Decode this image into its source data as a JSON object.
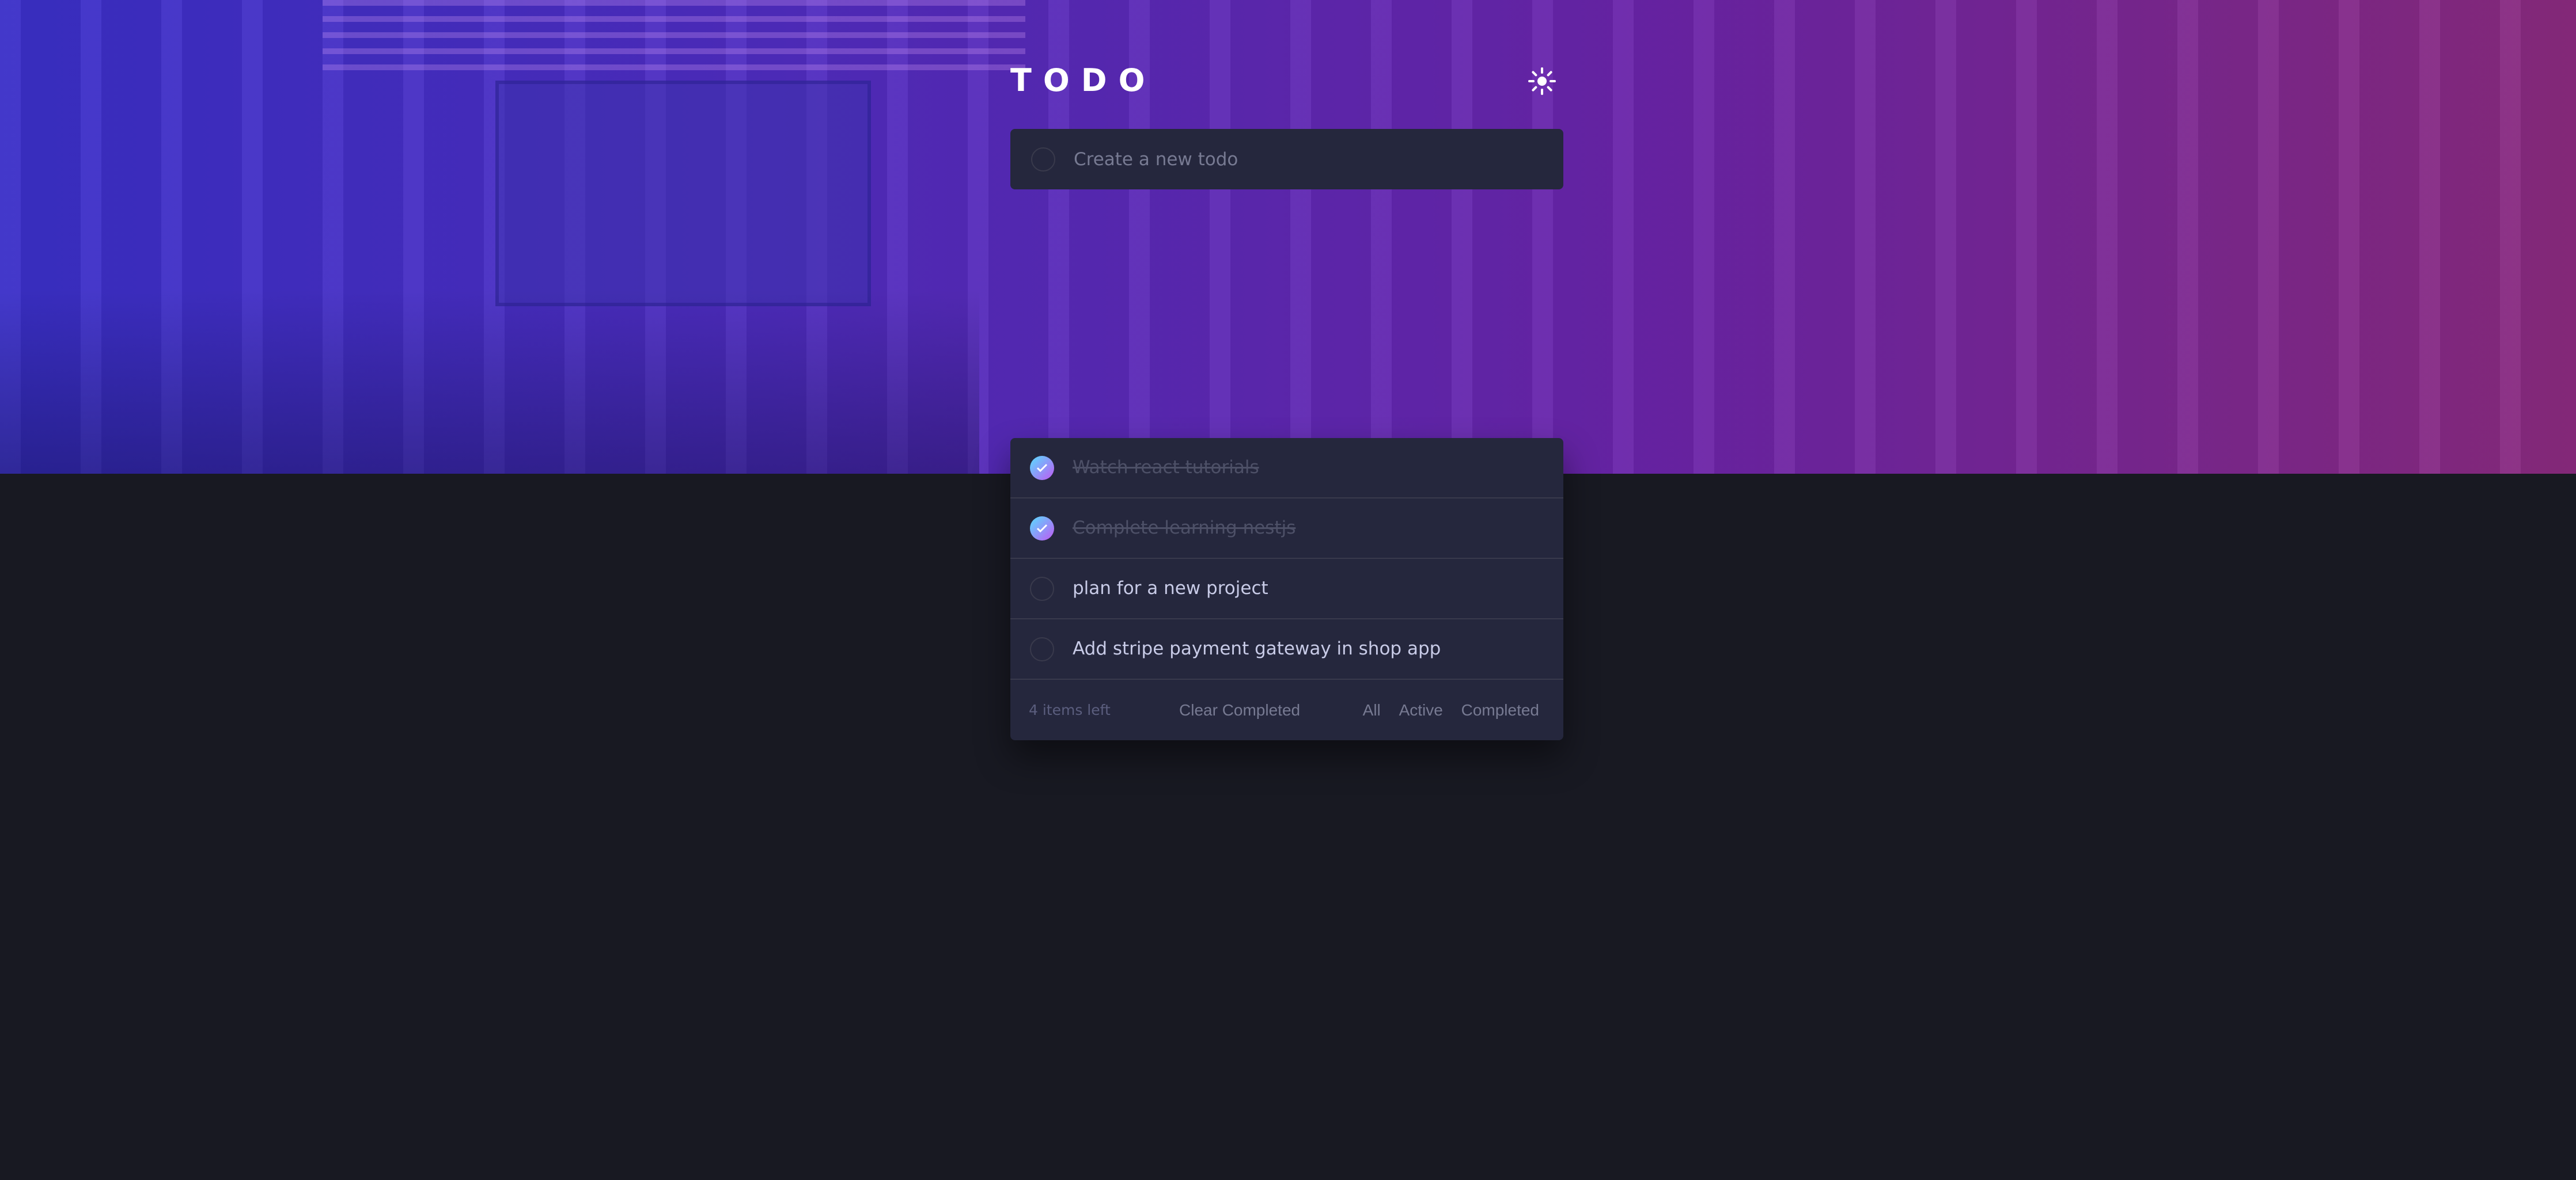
{
  "header": {
    "title": "TODO",
    "theme_icon": "sun-icon"
  },
  "new_todo": {
    "placeholder": "Create a new todo",
    "value": ""
  },
  "todos": [
    {
      "text": "Watch react tutorials",
      "completed": true
    },
    {
      "text": "Complete learning nestjs",
      "completed": true
    },
    {
      "text": "plan for a new project",
      "completed": false
    },
    {
      "text": "Add stripe payment gateway in shop app",
      "completed": false
    }
  ],
  "footer": {
    "items_left": "4 items left",
    "clear_completed": "Clear Completed",
    "filters": [
      "All",
      "Active",
      "Completed"
    ]
  },
  "colors": {
    "background": "#181922",
    "card": "#25273d",
    "divider": "#393a4c",
    "check_gradient_start": "#57ddff",
    "check_gradient_end": "#c058f3",
    "text_primary": "#c8cbe7",
    "text_completed": "#4d5067",
    "text_muted": "#777a92"
  }
}
